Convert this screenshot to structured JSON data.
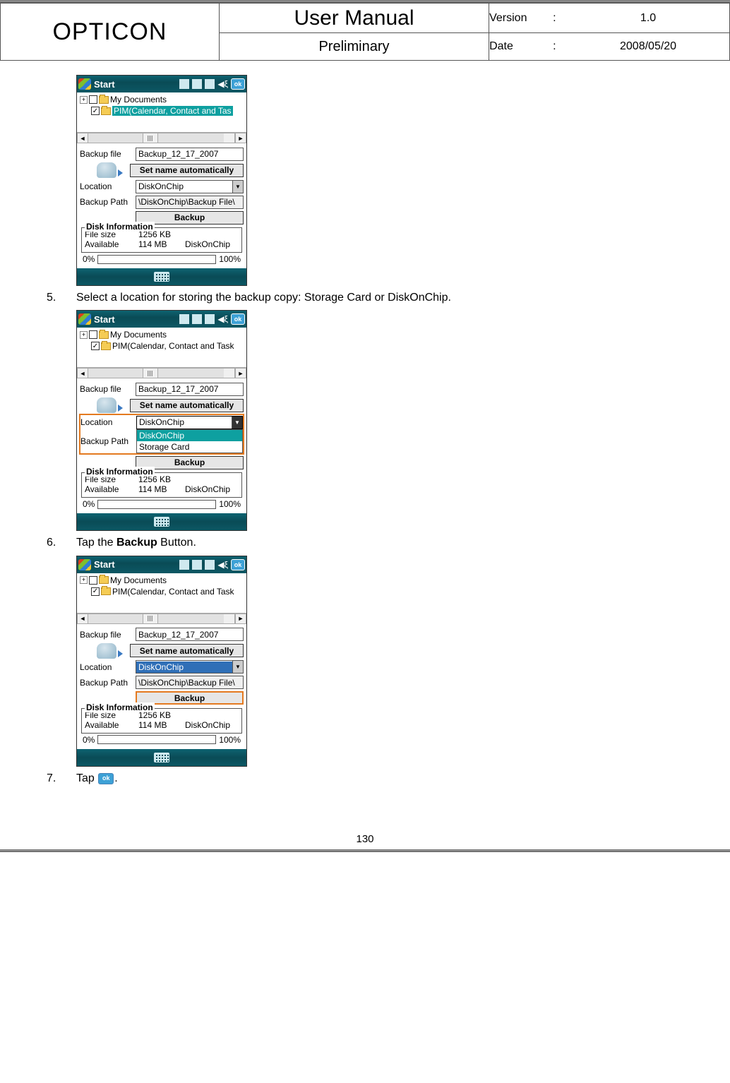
{
  "header": {
    "logo": "OPTICON",
    "title": "User Manual",
    "subtitle": "Preliminary",
    "version_label": "Version",
    "version_value": "1.0",
    "date_label": "Date",
    "date_value": "2008/05/20",
    "colon": ":"
  },
  "steps": {
    "s5": {
      "num": "5.",
      "text_a": "Select a location for storing the backup copy: ",
      "text_b": "Storage Card or DiskOnChip."
    },
    "s6": {
      "num": "6.",
      "text_a": "Tap the ",
      "bold": "Backup",
      "text_b": " Button."
    },
    "s7": {
      "num": "7.",
      "text_a": "Tap ",
      "text_b": "."
    }
  },
  "wm": {
    "start": "Start",
    "ok": "ok",
    "tree": {
      "my_documents": "My Documents",
      "pim_full": "PIM(Calendar, Contact and Task",
      "pim_trunc": "PIM(Calendar, Contact and Tas"
    },
    "labels": {
      "backup_file": "Backup file",
      "location": "Location",
      "backup_path": "Backup Path"
    },
    "values": {
      "backup_file": "Backup_12_17_2007",
      "set_auto": "Set name automatically",
      "location": "DiskOnChip",
      "backup_path": "\\DiskOnChip\\Backup File\\",
      "backup_btn": "Backup",
      "storage_card": "Storage Card"
    },
    "disk_info": {
      "legend": "Disk Information",
      "file_size_l": "File size",
      "file_size_v": "1256 KB",
      "available_l": "Available",
      "available_v": "114 MB",
      "available_loc": "DiskOnChip"
    },
    "progress": {
      "left": "0%",
      "right": "100%"
    }
  },
  "footer": {
    "page": "130"
  }
}
